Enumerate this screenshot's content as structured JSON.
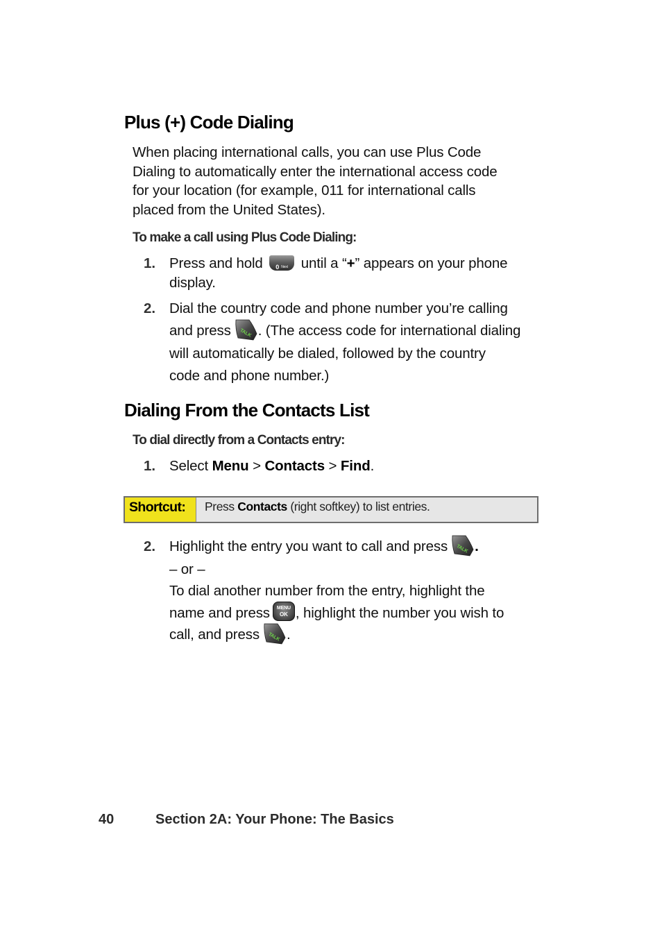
{
  "section1": {
    "heading": "Plus (+) Code Dialing",
    "intro_lines": [
      "When placing international calls, you can use Plus Code",
      "Dialing to automatically enter the international access code",
      "for your location (for example, 011 for international calls",
      "placed from the United States)."
    ],
    "subheading": "To make a call using Plus Code Dialing:",
    "steps": [
      {
        "num": "1.",
        "pre": "Press and hold",
        "key_icon": "zero-next-key-icon",
        "key_label": "0",
        "key_sublabel": "Next",
        "mid": "until a “",
        "bold": "+",
        "post": "” appears on your phone",
        "line2": "display."
      },
      {
        "num": "2.",
        "line1": "Dial the country code and phone number you’re calling",
        "pre": "and press",
        "key_icon": "talk-key-icon",
        "post": ". (The access code for international dialing",
        "line3": "will automatically be dialed, followed by the country",
        "line4": "code and phone number.)"
      }
    ]
  },
  "section2": {
    "heading": "Dialing From the Contacts List",
    "subheading": "To dial directly from a Contacts entry:",
    "step1": {
      "num": "1.",
      "pre": "Select ",
      "menu": "Menu",
      "sep1": " > ",
      "contacts": "Contacts",
      "sep2": " > ",
      "find": "Find",
      "end": "."
    },
    "shortcut": {
      "label": "Shortcut:",
      "pre": "Press ",
      "bold": "Contacts",
      "post": " (right softkey) to list entries.",
      "label_bg": "#f0e21c",
      "box_bg": "#e6e6e6"
    },
    "step2": {
      "num": "2.",
      "line1_pre": "Highlight the entry you want to call and press",
      "line1_post": ".",
      "or": "– or –",
      "line3": "To dial another number from the entry, highlight the",
      "line4_pre": "name and press",
      "menu_key_top": "MENU",
      "menu_key_bottom": "OK",
      "line4_post": ", highlight the number you wish to",
      "line5_pre": "call, and press",
      "line5_post": "."
    }
  },
  "footer": {
    "page_number": "40",
    "section_title": "Section 2A: Your Phone: The Basics"
  }
}
